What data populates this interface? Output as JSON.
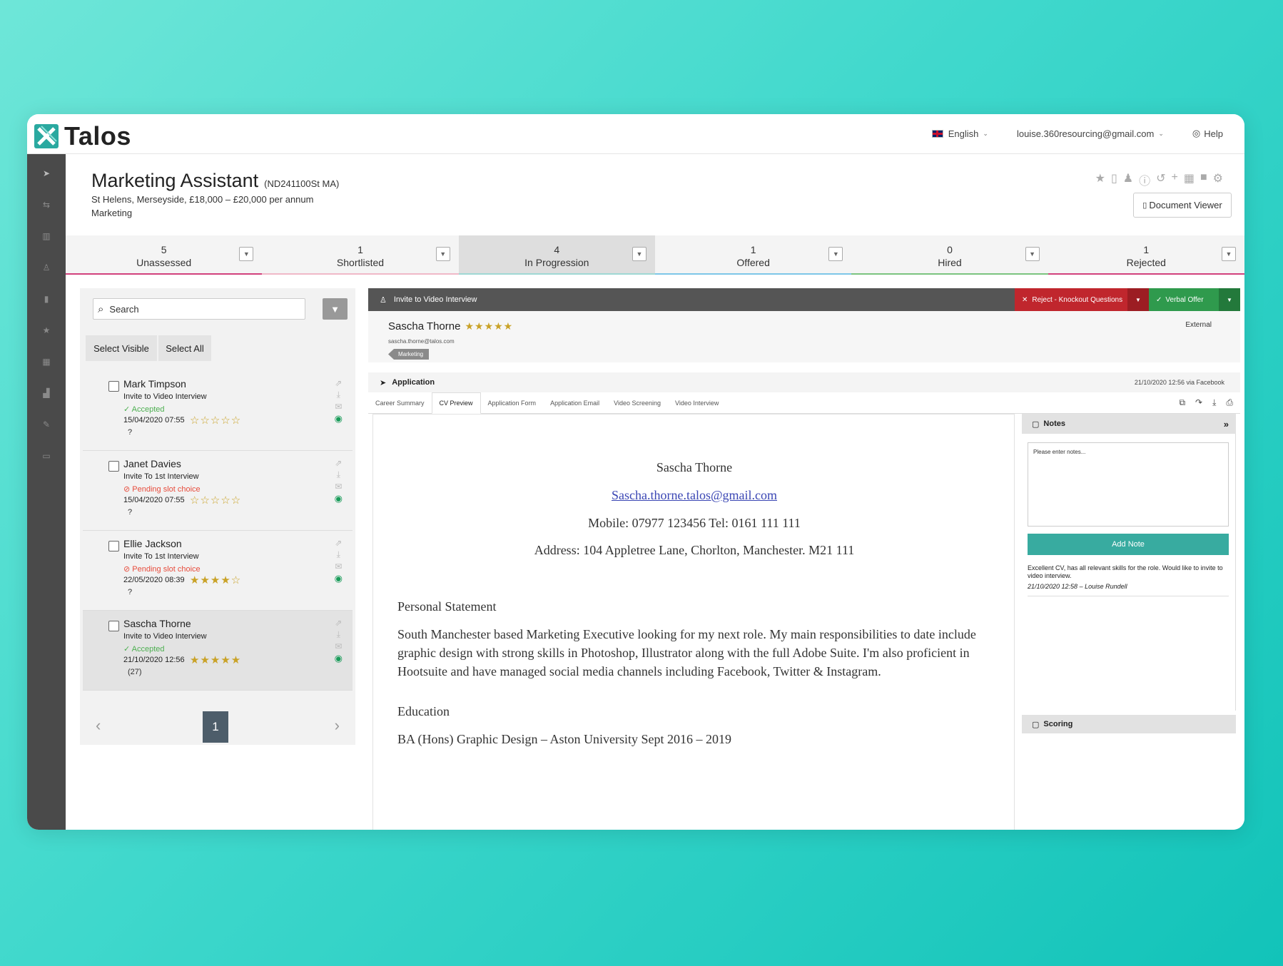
{
  "brand": {
    "name": "Talos",
    "accent": "#2aa9a0"
  },
  "topnav": {
    "language": "English",
    "user": "louise.360resourcing@gmail.com",
    "help": "Help"
  },
  "job": {
    "title": "Marketing Assistant",
    "ref": "(ND241100St MA)",
    "location": "St Helens, Merseyside, £18,000 – £20,000 per annum",
    "category": "Marketing",
    "document_viewer": "Document Viewer"
  },
  "pipeline": [
    {
      "count": "5",
      "label": "Unassessed",
      "color": "#d1417c"
    },
    {
      "count": "1",
      "label": "Shortlisted",
      "color": "#f0b8c8"
    },
    {
      "count": "4",
      "label": "In Progression",
      "color": "#9fd8d4"
    },
    {
      "count": "1",
      "label": "Offered",
      "color": "#7dc6e8"
    },
    {
      "count": "0",
      "label": "Hired",
      "color": "#7bc47f"
    },
    {
      "count": "1",
      "label": "Rejected",
      "color": "#d1417c"
    }
  ],
  "left": {
    "search_placeholder": "Search",
    "select_visible": "Select Visible",
    "select_all": "Select All",
    "candidates": [
      {
        "name": "Mark Timpson",
        "stage": "Invite to Video Interview",
        "status": "✓ Accepted",
        "status_type": "ok",
        "date": "15/04/2020 07:55",
        "stars": "☆☆☆☆☆",
        "extra": "?"
      },
      {
        "name": "Janet Davies",
        "stage": "Invite To 1st Interview",
        "status": "Pending slot choice",
        "status_type": "pend",
        "date": "15/04/2020 07:55",
        "stars": "☆☆☆☆☆",
        "extra": "?"
      },
      {
        "name": "Ellie Jackson",
        "stage": "Invite To 1st Interview",
        "status": "Pending slot choice",
        "status_type": "pend",
        "date": "22/05/2020 08:39",
        "stars": "★★★★☆",
        "extra": "?"
      },
      {
        "name": "Sascha Thorne",
        "stage": "Invite to Video Interview",
        "status": "✓ Accepted",
        "status_type": "ok",
        "date": "21/10/2020 12:56",
        "stars": "★★★★★",
        "extra": "(27)"
      }
    ],
    "page": "1"
  },
  "right": {
    "action_title": "Invite to Video Interview",
    "reject_label": "Reject - Knockout Questions",
    "offer_label": "Verbal Offer",
    "candidate": {
      "name": "Sascha Thorne",
      "stars": "★★★★★",
      "email": "sascha.thorne@talos.com",
      "tag": "Marketing",
      "source_type": "External"
    },
    "application": {
      "title": "Application",
      "date": "21/10/2020 12:56 via Facebook"
    },
    "tabs": [
      "Career Summary",
      "CV Preview",
      "Application Form",
      "Application Email",
      "Video Screening",
      "Video Interview"
    ],
    "cv": {
      "name": "Sascha Thorne",
      "email": "Sascha.thorne.talos@gmail.com",
      "phones": "Mobile: 07977 123456 Tel: 0161 111 111",
      "address": "Address: 104 Appletree Lane, Chorlton, Manchester. M21 111",
      "ps_heading": "Personal Statement",
      "ps_text": "South Manchester based Marketing Executive looking for my next role. My main responsibilities to date include graphic design with strong skills in Photoshop, Illustrator along with the full Adobe Suite. I'm also proficient in Hootsuite and have managed social media channels including Facebook, Twitter & Instagram.",
      "edu_heading": "Education",
      "edu_line": "BA (Hons) Graphic Design – Aston University Sept 2016 – 2019"
    },
    "notes": {
      "title": "Notes",
      "placeholder": "Please enter notes...",
      "add_button": "Add Note",
      "note_text": "Excellent CV, has all relevant skills for the role. Would like to invite to video interview.",
      "note_meta": "21/10/2020 12:58 – Louise Rundell",
      "scoring_title": "Scoring"
    }
  }
}
